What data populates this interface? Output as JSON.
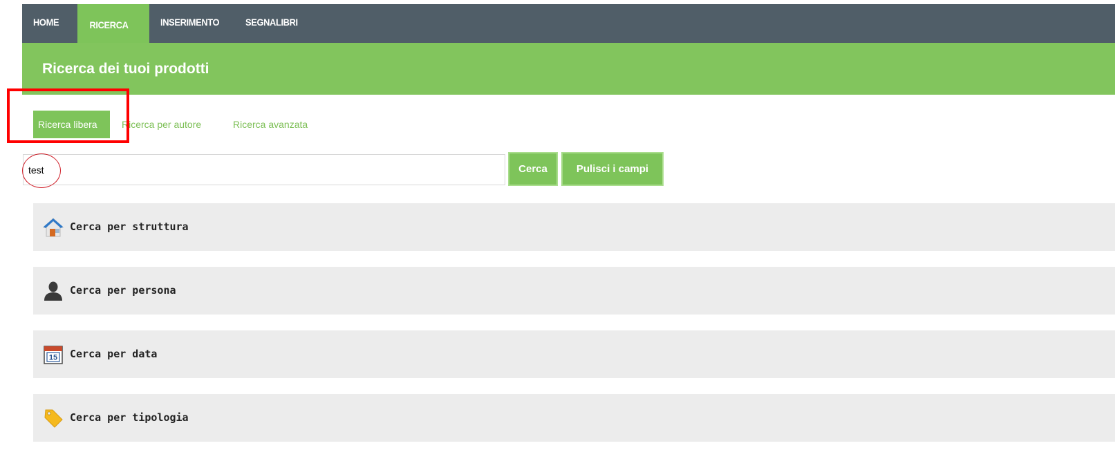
{
  "nav": {
    "home": "HOME",
    "ricerca": "RICERCA",
    "inserimento": "INSERIMENTO",
    "segnalibri": "SEGNALIBRI"
  },
  "header": {
    "title": "Ricerca dei tuoi prodotti"
  },
  "tabs": {
    "libera": "Ricerca libera",
    "autore": "Ricerca per autore",
    "avanzata": "Ricerca avanzata"
  },
  "search": {
    "value": "test",
    "cerca_label": "Cerca",
    "pulisci_label": "Pulisci i campi"
  },
  "sections": [
    {
      "label": "Cerca per struttura",
      "icon": "house-icon"
    },
    {
      "label": "Cerca per persona",
      "icon": "person-icon"
    },
    {
      "label": "Cerca per data",
      "icon": "calendar-icon"
    },
    {
      "label": "Cerca per tipologia",
      "icon": "tag-icon"
    }
  ],
  "calendar_icon_day": "15",
  "colors": {
    "nav_bg": "#505e68",
    "accent_green": "#7ec45a",
    "title_green": "#82c55d",
    "section_bg": "#ececec",
    "annotation_red": "#ff0000"
  }
}
